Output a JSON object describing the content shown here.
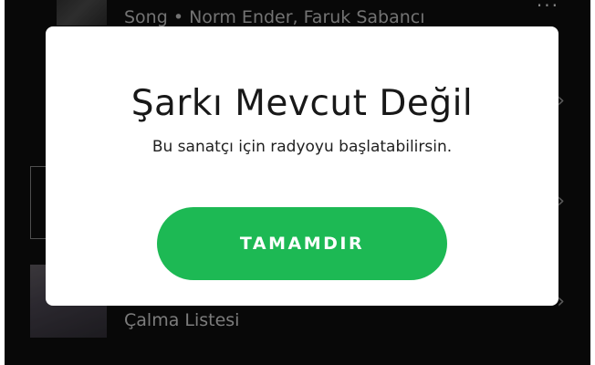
{
  "background": {
    "song_row_text": "Song • Norm Ender, Faruk Sabancı",
    "playlist_row_text": "Çalma Listesi",
    "more_icon": "more-options-icon",
    "chevron_icon": "chevron-right-icon"
  },
  "dialog": {
    "title": "Şarkı Mevcut Değil",
    "message": "Bu sanatçı için radyoyu başlatabilirsin.",
    "ok_label": "TAMAMDIR"
  },
  "colors": {
    "accent_green": "#1db954",
    "dialog_bg": "#ffffff",
    "app_bg": "#0b0b0b"
  }
}
